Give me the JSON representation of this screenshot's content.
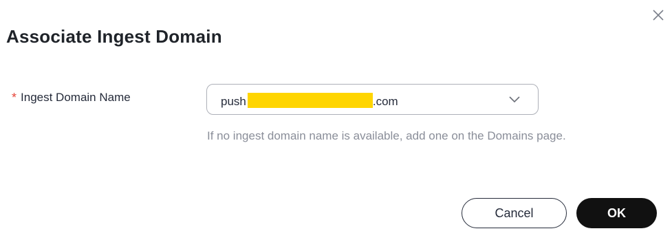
{
  "dialog": {
    "title": "Associate Ingest Domain",
    "close_icon": "close-icon"
  },
  "form": {
    "required_mark": "*",
    "field_label": "Ingest Domain Name",
    "select": {
      "value_prefix": "push",
      "value_suffix": ".com",
      "redaction_color": "#ffd500",
      "chevron_icon": "chevron-down-icon"
    },
    "hint": "If no ingest domain name is available, add one on the Domains page."
  },
  "footer": {
    "cancel_label": "Cancel",
    "ok_label": "OK"
  },
  "colors": {
    "required": "#e6453a",
    "primary_button": "#111111",
    "hint_text": "#8a8e99"
  }
}
